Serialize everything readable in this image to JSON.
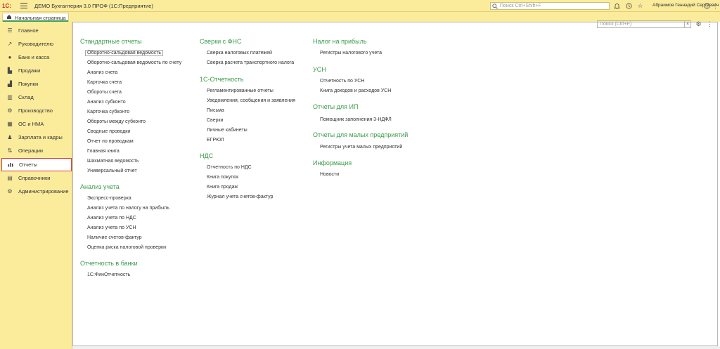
{
  "titlebar": {
    "logo": "1С:",
    "app_title": "ДЕМО Бухгалтерия 3.0 ПРОФ   (1С:Предприятие)",
    "search_placeholder": "Поиск Ctrl+Shift+F",
    "user": "Абраимов Геннадий Сергеевич",
    "icons": [
      "menu-icon",
      "search-icon",
      "bell-icon",
      "history-icon",
      "star-icon",
      "info-icon",
      "more-icon"
    ]
  },
  "tabs": {
    "home_label": "Начальная страница",
    "home_icon": "home-icon"
  },
  "sidebar": {
    "items": [
      {
        "label": "Главное",
        "icon": "list-icon"
      },
      {
        "label": "Руководителю",
        "icon": "chart-up-icon"
      },
      {
        "label": "Банк и касса",
        "icon": "coin-icon"
      },
      {
        "label": "Продажи",
        "icon": "cart-icon"
      },
      {
        "label": "Покупки",
        "icon": "basket-icon"
      },
      {
        "label": "Склад",
        "icon": "warehouse-icon"
      },
      {
        "label": "Производство",
        "icon": "factory-icon"
      },
      {
        "label": "ОС и НМА",
        "icon": "building-icon"
      },
      {
        "label": "Зарплата и кадры",
        "icon": "people-icon"
      },
      {
        "label": "Операции",
        "icon": "operations-icon"
      },
      {
        "label": "Отчеты",
        "icon": "bar-chart-icon",
        "active": true
      },
      {
        "label": "Справочники",
        "icon": "book-icon"
      },
      {
        "label": "Администрирование",
        "icon": "gear-icon"
      }
    ]
  },
  "content": {
    "search_placeholder": "Поиск (Ctrl+F)",
    "sections": {
      "standard": {
        "title": "Стандартные отчеты",
        "items": [
          "Оборотно-сальдовая ведомость",
          "Оборотно-сальдовая ведомость по счету",
          "Анализ счета",
          "Карточка счета",
          "Обороты счета",
          "Анализ субконто",
          "Карточка субконто",
          "Обороты между субконто",
          "Сводные проводки",
          "Отчет по проводкам",
          "Главная книга",
          "Шахматная ведомость",
          "Универсальный отчет"
        ]
      },
      "analysis": {
        "title": "Анализ учета",
        "items": [
          "Экспресс-проверка",
          "Анализ учета по налогу на прибыль",
          "Анализ учета по НДС",
          "Анализ учета по УСН",
          "Наличие счетов-фактур",
          "Оценка риска налоговой проверки"
        ]
      },
      "bank": {
        "title": "Отчетность в банки",
        "items": [
          "1С:ФинОтчетность"
        ]
      },
      "fns": {
        "title": "Сверки с ФНС",
        "items": [
          "Сверка налоговых платежей",
          "Сверка расчета транспортного налога"
        ]
      },
      "reporting": {
        "title": "1С-Отчетность",
        "items": [
          "Регламентированные отчеты",
          "Уведомления, сообщения и заявления",
          "Письма",
          "Сверки",
          "Личные кабинеты",
          "ЕГРЮЛ"
        ]
      },
      "vat": {
        "title": "НДС",
        "items": [
          "Отчетность по НДС",
          "Книга покупок",
          "Книга продаж",
          "Журнал учета счетов-фактур"
        ]
      },
      "profit": {
        "title": "Налог на прибыль",
        "items": [
          "Регистры налогового учета"
        ]
      },
      "usn": {
        "title": "УСН",
        "items": [
          "Отчетность по УСН",
          "Книга доходов и расходов УСН"
        ]
      },
      "ip": {
        "title": "Отчеты для ИП",
        "items": [
          "Помощник заполнения 3-НДФЛ"
        ]
      },
      "small": {
        "title": "Отчеты для малых предприятий",
        "items": [
          "Регистры учета малых предприятий"
        ]
      },
      "info": {
        "title": "Информация",
        "items": [
          "Новости"
        ]
      }
    }
  }
}
